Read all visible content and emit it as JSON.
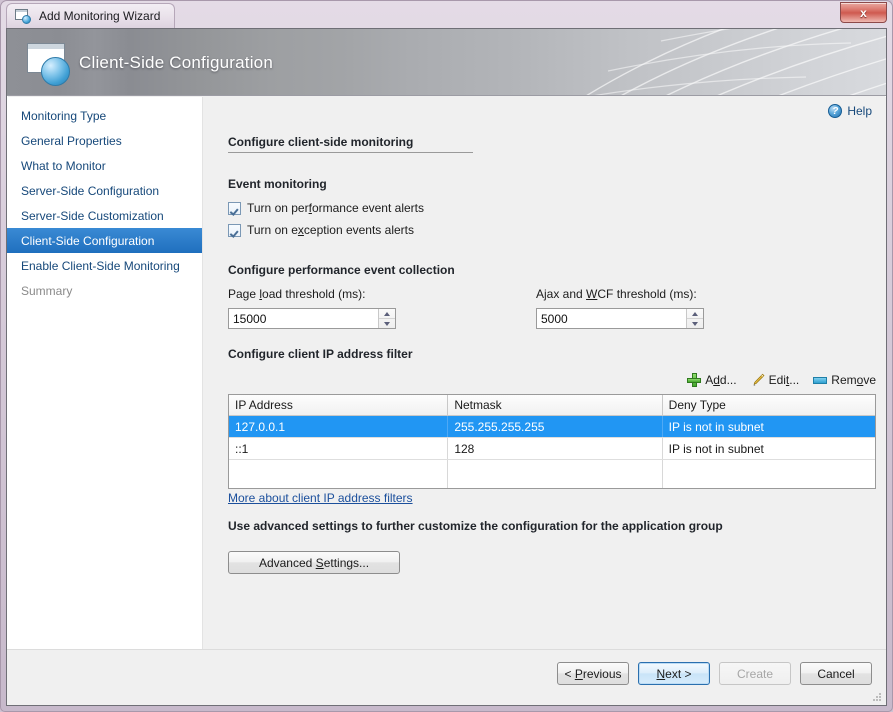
{
  "window": {
    "title": "Add Monitoring Wizard",
    "title_icon": "window-sphere-icon",
    "close_label": "x",
    "close_icon": "close-icon"
  },
  "banner": {
    "title": "Client-Side Configuration",
    "icon": "window-sphere-icon"
  },
  "help": {
    "label": "Help",
    "icon": "help-circle-icon",
    "glyph": "?"
  },
  "sidebar": {
    "items": [
      {
        "label": "Monitoring Type",
        "state": "normal"
      },
      {
        "label": "General Properties",
        "state": "normal"
      },
      {
        "label": "What to Monitor",
        "state": "normal"
      },
      {
        "label": "Server-Side Configuration",
        "state": "normal"
      },
      {
        "label": "Server-Side Customization",
        "state": "normal"
      },
      {
        "label": "Client-Side Configuration",
        "state": "current"
      },
      {
        "label": "Enable Client-Side Monitoring",
        "state": "normal"
      },
      {
        "label": "Summary",
        "state": "disabled"
      }
    ]
  },
  "main": {
    "section_title": "Configure client-side monitoring",
    "event_monitoring": {
      "heading": "Event monitoring",
      "checkboxes": [
        {
          "label_pre": "Turn on per",
          "label_accel": "f",
          "label_post": "ormance event alerts",
          "checked": true
        },
        {
          "label_pre": "Turn on e",
          "label_accel": "x",
          "label_post": "ception events alerts",
          "checked": true
        }
      ]
    },
    "performance_collection": {
      "heading": "Configure performance event collection",
      "fields": [
        {
          "label_pre": "Page ",
          "label_accel": "l",
          "label_post": "oad threshold (ms):",
          "value": "15000"
        },
        {
          "label_pre": "Ajax and ",
          "label_accel": "W",
          "label_post": "CF threshold (ms):",
          "value": "5000"
        }
      ]
    },
    "ip_filter": {
      "heading": "Configure client IP address filter",
      "toolbar": [
        {
          "label_pre": "A",
          "label_accel": "d",
          "label_post": "d...",
          "icon": "plus-icon"
        },
        {
          "label_pre": "Edi",
          "label_accel": "t",
          "label_post": "...",
          "icon": "pencil-icon"
        },
        {
          "label_pre": "Rem",
          "label_accel": "o",
          "label_post": "ve",
          "icon": "dash-icon"
        }
      ],
      "columns": [
        "IP Address",
        "Netmask",
        "Deny Type"
      ],
      "rows": [
        {
          "cells": [
            "127.0.0.1",
            "255.255.255.255",
            "IP is not in subnet"
          ],
          "selected": true
        },
        {
          "cells": [
            "::1",
            "128",
            "IP is not in subnet"
          ],
          "selected": false
        }
      ],
      "more_link": "More about client IP address filters"
    },
    "advanced": {
      "heading": "Use advanced settings to further customize the configuration for the application group",
      "button_pre": "Advanced ",
      "button_accel": "S",
      "button_post": "ettings..."
    }
  },
  "footer": {
    "buttons": [
      {
        "pre": "< ",
        "accel": "P",
        "post": "revious",
        "state": "normal"
      },
      {
        "pre": "",
        "accel": "N",
        "post": "ext >",
        "state": "default"
      },
      {
        "pre": "Create",
        "accel": "",
        "post": "",
        "state": "disabled"
      },
      {
        "pre": "Cancel",
        "accel": "",
        "post": "",
        "state": "normal"
      }
    ]
  },
  "colors": {
    "accent_selection": "#2196f3",
    "nav_current": "#2a7cc8",
    "link": "#1b4f9c",
    "close_red": "#cf5a50"
  }
}
